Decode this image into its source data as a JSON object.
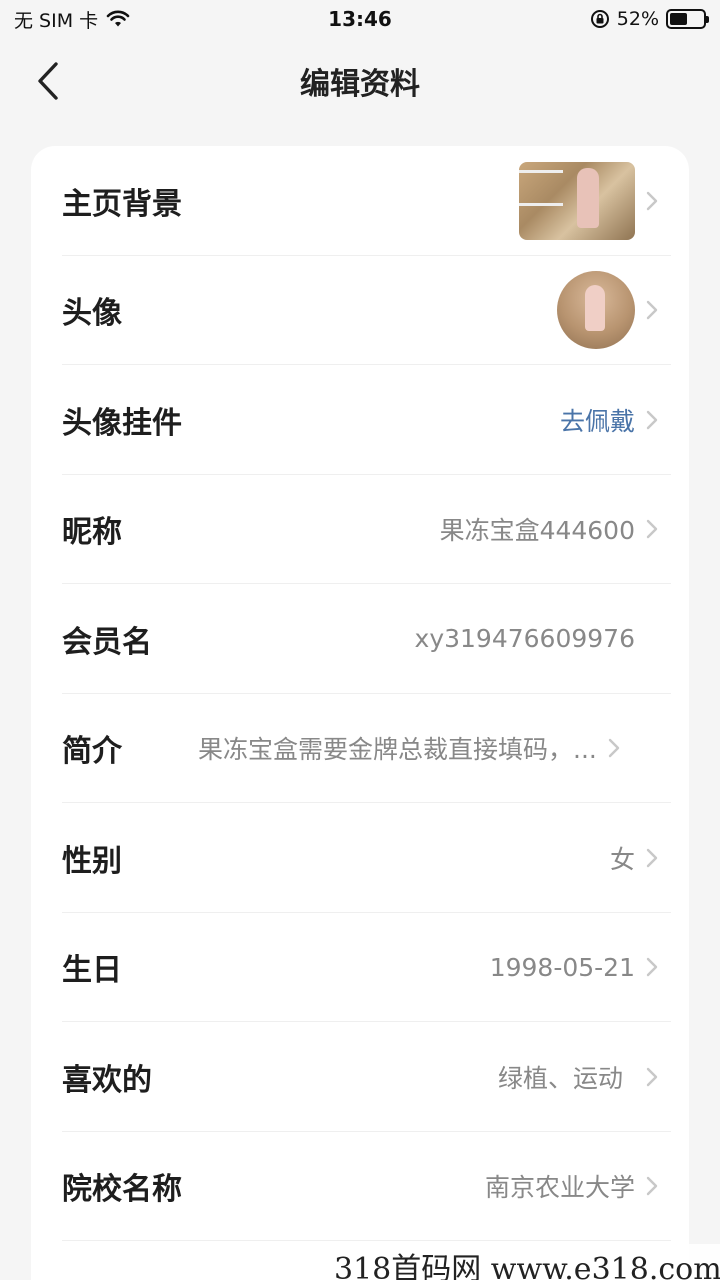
{
  "status_bar": {
    "carrier": "无 SIM 卡",
    "time": "13:46",
    "battery_percent": "52%",
    "battery_level": 0.52
  },
  "nav": {
    "title": "编辑资料",
    "back_icon": "chevron-left-icon"
  },
  "rows": [
    {
      "label": "主页背景",
      "type": "image-thumb"
    },
    {
      "label": "头像",
      "type": "avatar"
    },
    {
      "label": "头像挂件",
      "value": "去佩戴",
      "type": "link"
    },
    {
      "label": "昵称",
      "value": "果冻宝盒444600"
    },
    {
      "label": "会员名",
      "value": "xy319476609976"
    },
    {
      "label": "简介",
      "value": "果冻宝盒需要金牌总裁直接填码，..."
    },
    {
      "label": "性别",
      "value": "女"
    },
    {
      "label": "生日",
      "value": "1998-05-21"
    },
    {
      "label": "喜欢的",
      "value": "绿植、运动"
    },
    {
      "label": "院校名称",
      "value": "南京农业大学"
    }
  ],
  "watermark": "318首码网  www.e318.com",
  "colors": {
    "link": "#4a74a8",
    "value": "#888888",
    "background": "#f5f5f5"
  }
}
